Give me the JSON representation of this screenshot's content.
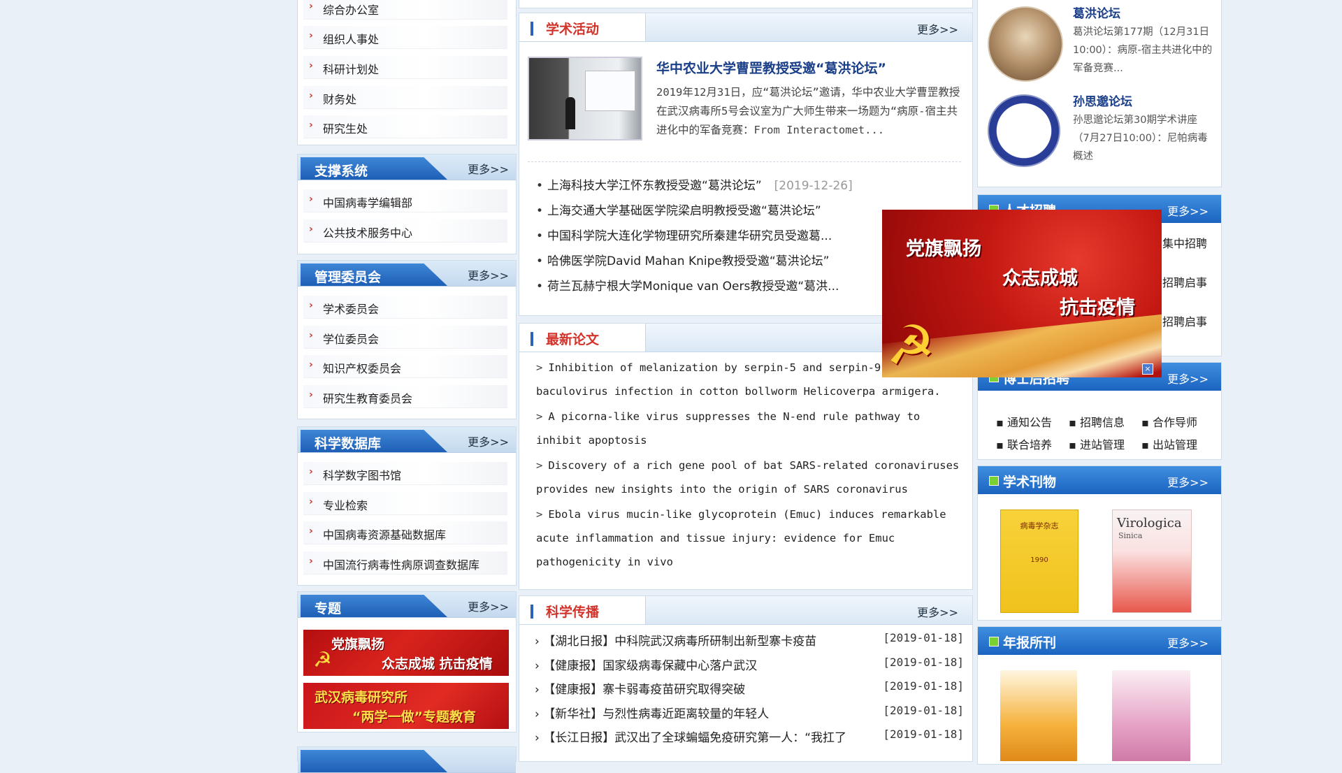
{
  "left": {
    "top_items": [
      "综合办公室",
      "组织人事处",
      "科研计划处",
      "财务处",
      "研究生处"
    ],
    "support": {
      "title": "支撑系统",
      "more": "更多>>",
      "items": [
        "中国病毒学编辑部",
        "公共技术服务中心"
      ]
    },
    "committee": {
      "title": "管理委员会",
      "more": "更多>>",
      "items": [
        "学术委员会",
        "学位委员会",
        "知识产权委员会",
        "研究生教育委员会"
      ]
    },
    "database": {
      "title": "科学数据库",
      "more": "更多>>",
      "items": [
        "科学数字图书馆",
        "专业检索",
        "中国病毒资源基础数据库",
        "中国流行病毒性病原调查数据库"
      ]
    },
    "topics": {
      "title": "专题",
      "more": "更多>>",
      "banner1": {
        "line1": "党旗飘扬",
        "line2": "众志成城 抗击疫情"
      },
      "banner2": {
        "line1": "武汉病毒研究所",
        "line2": "“两学一做”专题教育"
      }
    }
  },
  "academic": {
    "title": "学术活动",
    "more": "更多>>",
    "feature": {
      "headline": "华中农业大学曹罡教授受邀“葛洪论坛”",
      "summary": "2019年12月31日，应“葛洪论坛”邀请，华中农业大学曹罡教授在武汉病毒所5号会议室为广大师生带来一场题为“病原-宿主共进化中的军备竞赛：From Interactomet..."
    },
    "list": [
      {
        "text": "上海科技大学江怀东教授受邀“葛洪论坛”",
        "date": "[2019-12-26]"
      },
      {
        "text": "上海交通大学基础医学院梁启明教授受邀“葛洪论坛”",
        "date": ""
      },
      {
        "text": "中国科学院大连化学物理研究所秦建华研究员受邀葛...",
        "date": ""
      },
      {
        "text": "哈佛医学院David Mahan Knipe教授受邀“葛洪论坛”",
        "date": ""
      },
      {
        "text": "荷兰瓦赫宁根大学Monique van Oers教授受邀“葛洪...",
        "date": ""
      }
    ]
  },
  "papers": {
    "title": "最新论文",
    "items": [
      {
        "line1": "Inhibition of melanization by serpin-5 and serpin-9",
        "line2": "baculovirus infection in cotton bollworm Helicoverpa armigera."
      },
      {
        "line1": "A picorna-like virus suppresses the N-end rule pathway to",
        "line2": "inhibit apoptosis"
      },
      {
        "line1": "Discovery of a rich gene pool of bat SARS-related coronaviruses",
        "line2": "provides new insights into the origin of SARS coronavirus"
      },
      {
        "line1": "Ebola virus mucin-like glycoprotein (Emuc) induces remarkable",
        "line2": "acute inflammation and tissue injury: evidence for Emuc",
        "line3": "pathogenicity in vivo"
      }
    ]
  },
  "outreach": {
    "title": "科学传播",
    "more": "更多>>",
    "items": [
      {
        "text": "【湖北日报】中科院武汉病毒所研制出新型寨卡疫苗",
        "date": "[2019-01-18]"
      },
      {
        "text": "【健康报】国家级病毒保藏中心落户武汉",
        "date": "[2019-01-18]"
      },
      {
        "text": "【健康报】寨卡弱毒疫苗研究取得突破",
        "date": "[2019-01-18]"
      },
      {
        "text": "【新华社】与烈性病毒近距离较量的年轻人",
        "date": "[2019-01-18]"
      },
      {
        "text": "【长江日报】武汉出了全球蝙蝠免疫研究第一人：“我扛了",
        "date": "[2019-01-18]"
      }
    ]
  },
  "right": {
    "forum1": {
      "title": "葛洪论坛",
      "desc": "葛洪论坛第177期（12月31日10:00）：病原-宿主共进化中的军备竞赛..."
    },
    "forum2": {
      "title": "孙思邈论坛",
      "desc": "孙思邈论坛第30期学术讲座（7月27日10:00）：尼帕病毒概述"
    },
    "talent": {
      "title": "人才招聘",
      "more": "更多>>",
      "items": [
        "集中招聘",
        "招聘启事",
        "招聘启事"
      ]
    },
    "postdoc": {
      "title": "博士后招聘",
      "more": "更多>>",
      "items": [
        "通知公告",
        "招聘信息",
        "合作导师",
        "联合培养",
        "进站管理",
        "出站管理"
      ]
    },
    "journals": {
      "title": "学术刊物",
      "more": "更多>>",
      "j1_title": "病毒学杂志",
      "j1_year": "1990",
      "j2_title": "Virologica",
      "j2_sub": "Sinica"
    },
    "annual": {
      "title": "年报所刊",
      "more": "更多>>"
    }
  },
  "popup": {
    "line1": "党旗飘扬",
    "line2": "众志成城",
    "line3": "抗击疫情"
  }
}
